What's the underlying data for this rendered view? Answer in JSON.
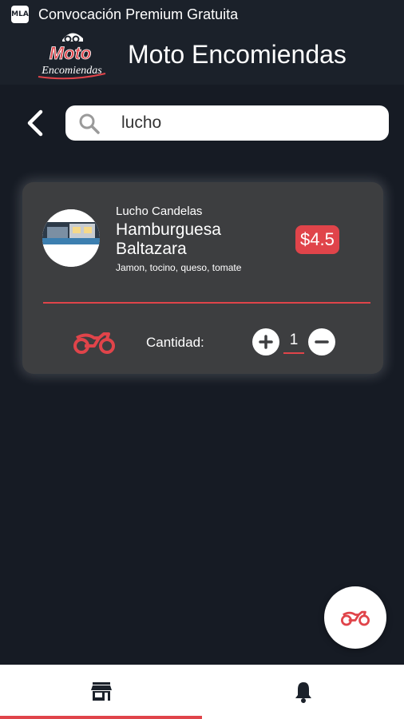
{
  "status_bar": {
    "app_badge": "MLA",
    "text": "Convocación Premium Gratuita"
  },
  "header": {
    "logo_top": "Moto",
    "logo_bottom": "Encomiendas",
    "title": "Moto Encomiendas"
  },
  "search": {
    "value": "lucho"
  },
  "product": {
    "vendor": "Lucho Candelas",
    "name": "Hamburguesa Baltazara",
    "description": "Jamon, tocino, queso, tomate",
    "price": "$4.5",
    "quantity_label": "Cantidad:",
    "quantity": "1"
  },
  "icons": {
    "back": "chevron-left-icon",
    "search": "search-icon",
    "moto": "motorcycle-icon",
    "store": "store-icon",
    "bell": "bell-icon"
  },
  "colors": {
    "accent": "#e0444a",
    "background": "#161b24",
    "card": "#3d3e40",
    "header": "#1b212a"
  }
}
